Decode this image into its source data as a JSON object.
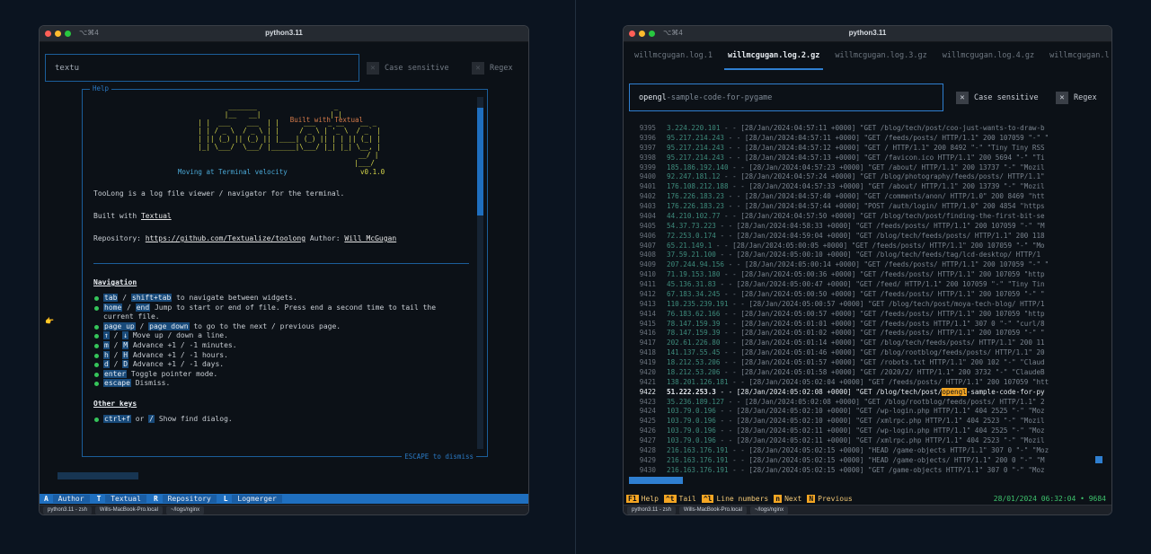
{
  "left_window": {
    "shortcut": "⌥⌘4",
    "title": "python3.11",
    "find_input": "textu",
    "case_sensitive_label": "Case sensitive",
    "regex_label": "Regex",
    "help": {
      "label": "Help",
      "logo_lines": [
        "  _______                   _ ",
        " |__   __|                 | |",
        "    | |  ___    ___  | |      ___   _ __    __ _ ",
        "    | | / _ \\  / _ \\ | |     / _ \\ | '_ \\  / _` |",
        "    | || (_) || (_) || |____| (_) || | | || (_| |",
        "    |_| \\___/  \\___/ |______|\\___/ |_| |_| \\__, |",
        "                                           __/ |",
        "                                          |___/ "
      ],
      "built_tag": "Built with Textual",
      "velocity": "Moving at Terminal velocity",
      "version": "v0.1.0",
      "intro": "TooLong is a log file viewer / navigator for the terminal.",
      "built_prefix": "Built with ",
      "built_link": "Textual",
      "repo_prefix": "Repository: ",
      "repo_link": "https://github.com/Textualize/toolong",
      "author_prefix": " Author: ",
      "author_link": "Will McGugan",
      "nav_heading": "Navigation",
      "nav_items": [
        {
          "k1": "tab",
          "sep": " / ",
          "k2": "shift+tab",
          "text": " to navigate between widgets."
        },
        {
          "k1": "home",
          "sep": " / ",
          "k2": "end",
          "text": " Jump to start or end of file. Press end a second time to tail the current file."
        },
        {
          "k1": "page up",
          "sep": " / ",
          "k2": "page down",
          "text": " to go to the next / previous page."
        },
        {
          "k1": "↑",
          "sep": " / ",
          "k2": "↓",
          "text": " Move up / down a line."
        },
        {
          "k1": "m",
          "sep": " / ",
          "k2": "M",
          "text": " Advance +1 / -1 minutes."
        },
        {
          "k1": "h",
          "sep": " / ",
          "k2": "H",
          "text": " Advance +1 / -1 hours."
        },
        {
          "k1": "d",
          "sep": " / ",
          "k2": "D",
          "text": " Advance +1 / -1 days."
        },
        {
          "k1": "enter",
          "sep": "",
          "k2": "",
          "text": " Toggle pointer mode."
        },
        {
          "k1": "escape",
          "sep": "",
          "k2": "",
          "text": " Dismiss."
        }
      ],
      "other_heading": "Other keys",
      "other_items": [
        {
          "k1": "ctrl+f",
          "sep": " or ",
          "k2": "/",
          "text": " Show find dialog."
        }
      ],
      "footer": "ESCAPE to dismiss"
    },
    "footer_items": [
      {
        "key": "A",
        "label": "Author"
      },
      {
        "key": "T",
        "label": "Textual"
      },
      {
        "key": "R",
        "label": "Repository"
      },
      {
        "key": "L",
        "label": "Logmerger"
      }
    ],
    "status_tabs": [
      "python3.11 - zsh",
      "Wills-MacBook-Pro.local",
      "~/logs/nginx"
    ]
  },
  "right_window": {
    "shortcut": "⌥⌘4",
    "title": "python3.11",
    "tabs": [
      "willmcgugan.log.1",
      "willmcgugan.log.2.gz",
      "willmcgugan.log.3.gz",
      "willmcgugan.log.4.gz",
      "willmcgugan.l"
    ],
    "active_tab": 1,
    "find_match": "opengl",
    "find_rest": "-sample-code-for-pygame",
    "case_sensitive_label": "Case sensitive",
    "regex_label": "Regex",
    "log_lines": [
      {
        "n": "9395",
        "ip": "3.224.220.101",
        "rest": " - - [28/Jan/2024:04:57:11 +0000] \"GET /blog/tech/post/coo-just-wants-to-draw-b"
      },
      {
        "n": "9396",
        "ip": "95.217.214.243",
        "rest": " - - [28/Jan/2024:04:57:11 +0000] \"GET /feeds/posts/ HTTP/1.1\" 200 107059 \"-\" \""
      },
      {
        "n": "9397",
        "ip": "95.217.214.243",
        "rest": " - - [28/Jan/2024:04:57:12 +0000] \"GET / HTTP/1.1\" 200 8492 \"-\" \"Tiny Tiny RSS"
      },
      {
        "n": "9398",
        "ip": "95.217.214.243",
        "rest": " - - [28/Jan/2024:04:57:13 +0000] \"GET /favicon.ico HTTP/1.1\" 200 5694 \"-\" \"Ti"
      },
      {
        "n": "9399",
        "ip": "185.186.192.140",
        "rest": " - - [28/Jan/2024:04:57:23 +0000] \"GET /about/ HTTP/1.1\" 200 13737 \"-\" \"Mozil"
      },
      {
        "n": "9400",
        "ip": "92.247.181.12",
        "rest": " - - [28/Jan/2024:04:57:24 +0000] \"GET /blog/photography/feeds/posts/ HTTP/1.1\""
      },
      {
        "n": "9401",
        "ip": "176.108.212.188",
        "rest": " - - [28/Jan/2024:04:57:33 +0000] \"GET /about/ HTTP/1.1\" 200 13739 \"-\" \"Mozil"
      },
      {
        "n": "9402",
        "ip": "176.226.183.23",
        "rest": " - - [28/Jan/2024:04:57:40 +0000] \"GET /comments/anon/ HTTP/1.0\" 200 8469 \"htt"
      },
      {
        "n": "9403",
        "ip": "176.226.183.23",
        "rest": " - - [28/Jan/2024:04:57:44 +0000] \"POST /auth/login/ HTTP/1.0\" 200 4854 \"https"
      },
      {
        "n": "9404",
        "ip": "44.210.102.77",
        "rest": " - - [28/Jan/2024:04:57:50 +0000] \"GET /blog/tech/post/finding-the-first-bit-se"
      },
      {
        "n": "9405",
        "ip": "54.37.73.223",
        "rest": " - - [28/Jan/2024:04:58:33 +0000] \"GET /feeds/posts/ HTTP/1.1\" 200 107059 \"-\" \"M"
      },
      {
        "n": "9406",
        "ip": "72.253.0.174",
        "rest": " - - [28/Jan/2024:04:59:04 +0000] \"GET /blog/tech/feeds/posts/ HTTP/1.1\" 200 118"
      },
      {
        "n": "9407",
        "ip": "65.21.149.1",
        "rest": " - - [28/Jan/2024:05:00:05 +0000] \"GET /feeds/posts/ HTTP/1.1\" 200 107059 \"-\" \"Mo"
      },
      {
        "n": "9408",
        "ip": "37.59.21.100",
        "rest": " - - [28/Jan/2024:05:00:10 +0000] \"GET /blog/tech/feeds/tag/lcd-desktop/ HTTP/1"
      },
      {
        "n": "9409",
        "ip": "207.244.94.156",
        "rest": " - - [28/Jan/2024:05:00:14 +0000] \"GET /feeds/posts/ HTTP/1.1\" 200 107059 \"-\" \""
      },
      {
        "n": "9410",
        "ip": "71.19.153.180",
        "rest": " - - [28/Jan/2024:05:00:36 +0000] \"GET /feeds/posts/ HTTP/1.1\" 200 107059 \"http"
      },
      {
        "n": "9411",
        "ip": "45.136.31.83",
        "rest": " - - [28/Jan/2024:05:00:47 +0000] \"GET /feed/ HTTP/1.1\" 200 107059 \"-\" \"Tiny Tin"
      },
      {
        "n": "9412",
        "ip": "67.183.34.245",
        "rest": " - - [28/Jan/2024:05:00:50 +0000] \"GET /feeds/posts/ HTTP/1.1\" 200 107059 \"-\" \""
      },
      {
        "n": "9413",
        "ip": "110.235.239.191",
        "rest": " - - [28/Jan/2024:05:00:57 +0000] \"GET /blog/tech/post/moya-tech-blog/ HTTP/1"
      },
      {
        "n": "9414",
        "ip": "76.183.62.166",
        "rest": " - - [28/Jan/2024:05:00:57 +0000] \"GET /feeds/posts/ HTTP/1.1\" 200 107059 \"http"
      },
      {
        "n": "9415",
        "ip": "78.147.159.39",
        "rest": " - - [28/Jan/2024:05:01:01 +0000] \"GET /feeds/posts HTTP/1.1\" 307 0 \"-\" \"curl/8"
      },
      {
        "n": "9416",
        "ip": "78.147.159.39",
        "rest": " - - [28/Jan/2024:05:01:02 +0000] \"GET /feeds/posts/ HTTP/1.1\" 200 107059 \"-\" \""
      },
      {
        "n": "9417",
        "ip": "202.61.226.80",
        "rest": " - - [28/Jan/2024:05:01:14 +0000] \"GET /blog/tech/feeds/posts/ HTTP/1.1\" 200 11"
      },
      {
        "n": "9418",
        "ip": "141.137.55.45",
        "rest": " - - [28/Jan/2024:05:01:46 +0000] \"GET /blog/rootblog/feeds/posts/ HTTP/1.1\" 20"
      },
      {
        "n": "9419",
        "ip": "18.212.53.206",
        "rest": " - - [28/Jan/2024:05:01:57 +0000] \"GET /robots.txt HTTP/1.1\" 200 102 \"-\" \"Claud"
      },
      {
        "n": "9420",
        "ip": "18.212.53.206",
        "rest": " - - [28/Jan/2024:05:01:58 +0000] \"GET /2020/2/ HTTP/1.1\" 200 3732 \"-\" \"ClaudeB"
      },
      {
        "n": "9421",
        "ip": "138.201.126.181",
        "rest": " - - [28/Jan/2024:05:02:04 +0000] \"GET /feeds/posts/ HTTP/1.1\" 200 107059 \"htt"
      },
      {
        "n": "9422",
        "ip": "51.222.253.3",
        "rest": " - - [28/Jan/2024:05:02:08 +0000] \"GET /blog/tech/post/",
        "match": "opengl",
        "after": "-sample-code-for-py",
        "highlight": true
      },
      {
        "n": "9423",
        "ip": "35.236.189.127",
        "rest": " - - [28/Jan/2024:05:02:08 +0000] \"GET /blog/rootblog/feeds/posts/ HTTP/1.1\" 2"
      },
      {
        "n": "9424",
        "ip": "103.79.0.196",
        "rest": " - - [28/Jan/2024:05:02:10 +0000] \"GET /wp-login.php HTTP/1.1\" 404 2525 \"-\" \"Moz"
      },
      {
        "n": "9425",
        "ip": "103.79.0.196",
        "rest": " - - [28/Jan/2024:05:02:10 +0000] \"GET /xmlrpc.php HTTP/1.1\" 404 2523 \"-\" \"Mozil"
      },
      {
        "n": "9426",
        "ip": "103.79.0.196",
        "rest": " - - [28/Jan/2024:05:02:11 +0000] \"GET /wp-login.php HTTP/1.1\" 404 2525 \"-\" \"Moz"
      },
      {
        "n": "9427",
        "ip": "103.79.0.196",
        "rest": " - - [28/Jan/2024:05:02:11 +0000] \"GET /xmlrpc.php HTTP/1.1\" 404 2523 \"-\" \"Mozil"
      },
      {
        "n": "9428",
        "ip": "216.163.176.191",
        "rest": " - - [28/Jan/2024:05:02:15 +0000] \"HEAD /game-objects HTTP/1.1\" 307 0 \"-\" \"Moz"
      },
      {
        "n": "9429",
        "ip": "216.163.176.191",
        "rest": " - - [28/Jan/2024:05:02:15 +0000] \"HEAD /game-objects/ HTTP/1.1\" 200 0 \"-\" \"M"
      },
      {
        "n": "9430",
        "ip": "216.163.176.191",
        "rest": " - - [28/Jan/2024:05:02:15 +0000] \"GET /game-objects HTTP/1.1\" 307 0 \"-\" \"Moz"
      }
    ],
    "footer_items": [
      {
        "key": "F1",
        "label": "Help"
      },
      {
        "key": "^t",
        "label": "Tail"
      },
      {
        "key": "^l",
        "label": "Line numbers"
      },
      {
        "key": "n",
        "label": "Next"
      },
      {
        "key": "N",
        "label": "Previous"
      }
    ],
    "timestamp": "28/01/2024 06:32:04 • 9684",
    "status_tabs": [
      "python3.11 - zsh",
      "Wills-MacBook-Pro.local",
      "~/logs/nginx"
    ]
  },
  "colors": {
    "accent": "#1f6fbf",
    "highlight": "#f5a623",
    "bullet": "#35c45a"
  }
}
